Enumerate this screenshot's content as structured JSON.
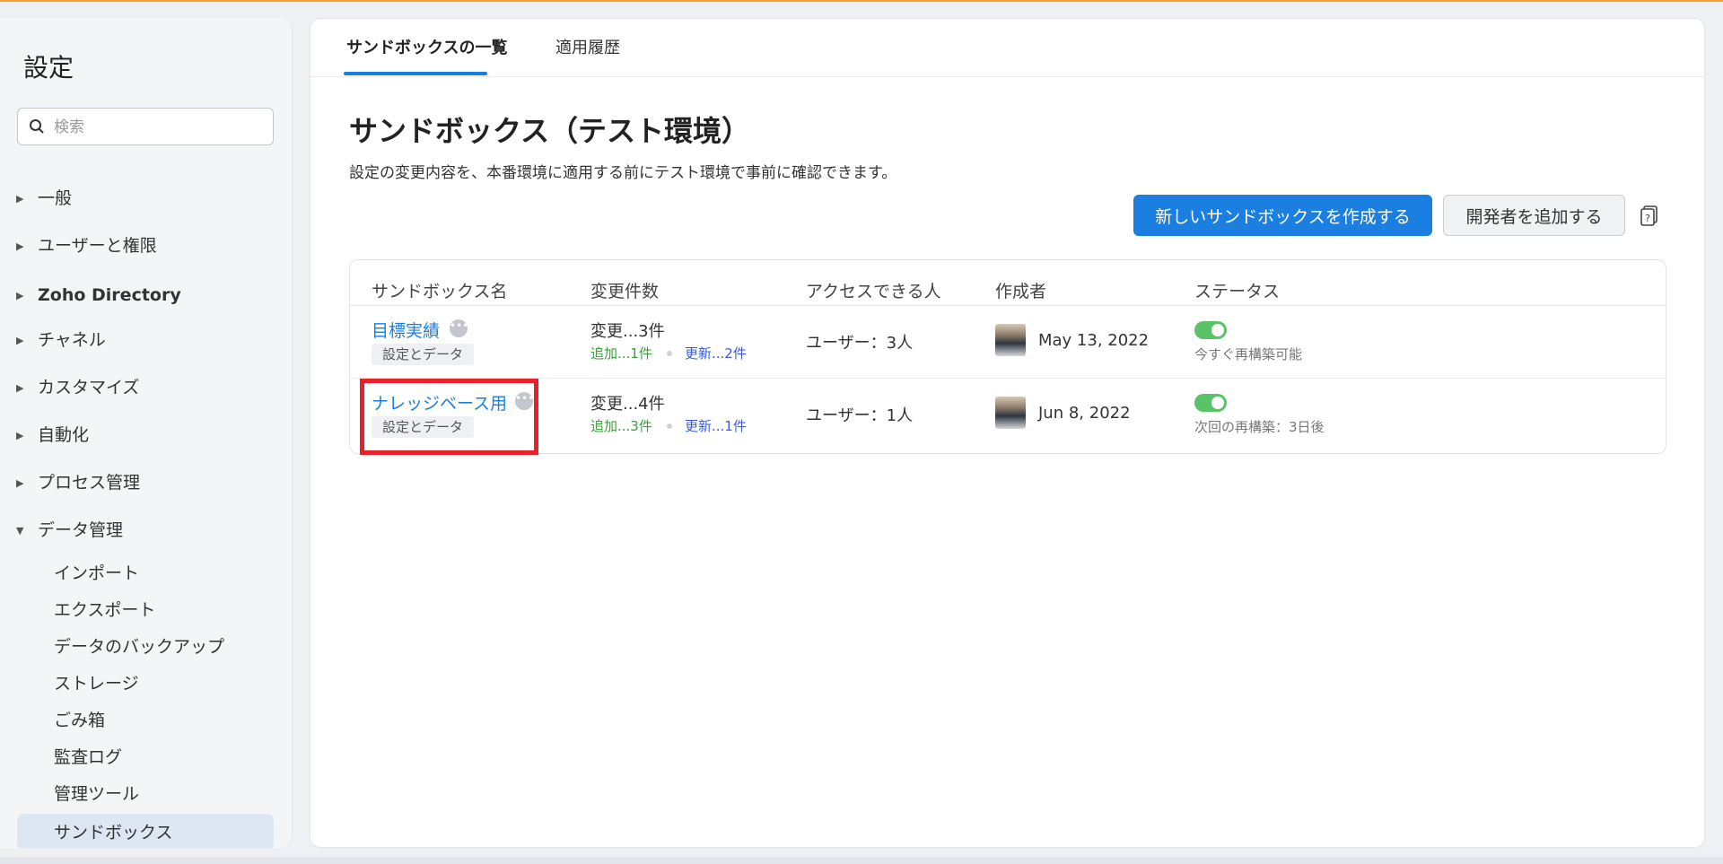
{
  "sidebar": {
    "title": "設定",
    "search_placeholder": "検索",
    "nav": [
      {
        "label": "一般"
      },
      {
        "label": "ユーザーと権限"
      },
      {
        "label": "Zoho Directory"
      },
      {
        "label": "チャネル"
      },
      {
        "label": "カスタマイズ"
      },
      {
        "label": "自動化"
      },
      {
        "label": "プロセス管理"
      },
      {
        "label": "データ管理"
      }
    ],
    "sub_items": [
      {
        "label": "インポート"
      },
      {
        "label": "エクスポート"
      },
      {
        "label": "データのバックアップ"
      },
      {
        "label": "ストレージ"
      },
      {
        "label": "ごみ箱"
      },
      {
        "label": "監査ログ"
      },
      {
        "label": "管理ツール"
      },
      {
        "label": "サンドボックス"
      }
    ]
  },
  "tabs": [
    {
      "label": "サンドボックスの一覧",
      "active": true
    },
    {
      "label": "適用履歴",
      "active": false
    }
  ],
  "page": {
    "title": "サンドボックス（テスト環境）",
    "description": "設定の変更内容を、本番環境に適用する前にテスト環境で事前に確認できます。",
    "create_button": "新しいサンドボックスを作成する",
    "add_dev_button": "開発者を追加する"
  },
  "table": {
    "headers": [
      "サンドボックス名",
      "変更件数",
      "アクセスできる人",
      "作成者",
      "ステータス"
    ],
    "rows": [
      {
        "name": "目標実績",
        "tag": "設定とデータ",
        "changes": "変更...3件",
        "added": "追加...1件",
        "updated": "更新...2件",
        "access": "ユーザー：3人",
        "created": "May 13, 2022",
        "status": "今すぐ再構築可能"
      },
      {
        "name": "ナレッジベース用",
        "tag": "設定とデータ",
        "changes": "変更...4件",
        "added": "追加...3件",
        "updated": "更新...1件",
        "access": "ユーザー：1人",
        "created": "Jun 8, 2022",
        "status": "次回の再構築：3日後"
      }
    ]
  },
  "colors": {
    "accent": "#1a7fe0",
    "highlight": "#e8202a",
    "toggle_on": "#5cc26a"
  }
}
